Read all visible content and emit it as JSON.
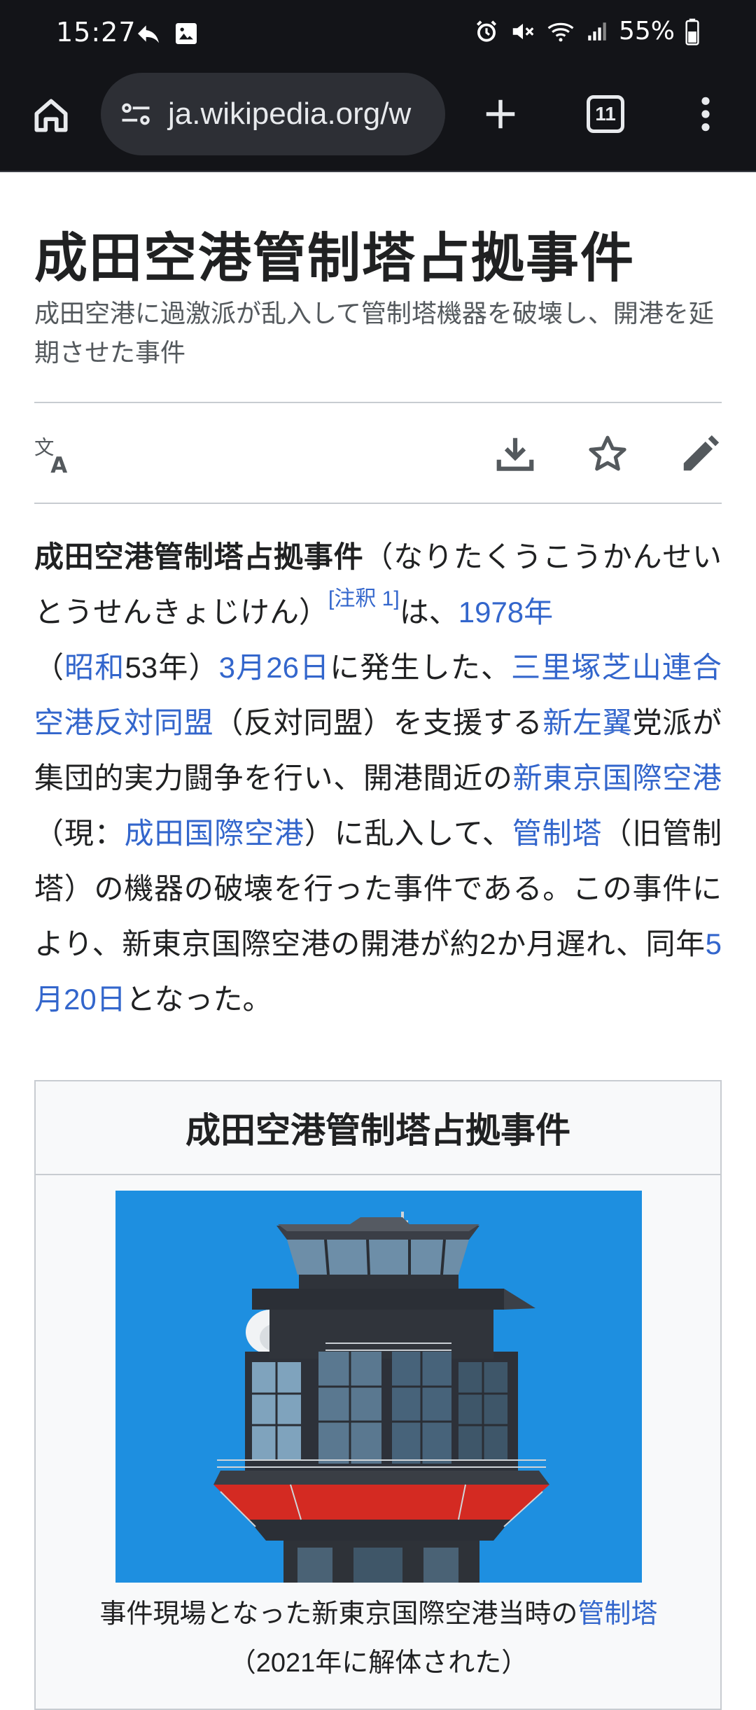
{
  "status_bar": {
    "time": "15:27",
    "battery": "55%",
    "icons": [
      "reply-arrow-icon",
      "gallery-icon",
      "alarm-icon",
      "mute-icon",
      "wifi-icon",
      "signal-icon",
      "battery-icon"
    ]
  },
  "browser": {
    "url": "ja.wikipedia.org/w",
    "tab_count": "11",
    "icons": [
      "home-icon",
      "site-info-icon",
      "plus-icon",
      "tabs-icon",
      "more-vert-icon"
    ]
  },
  "article": {
    "title": "成田空港管制塔占拠事件",
    "subtitle": "成田空港に過激派が乱入して管制塔機器を破壊し、開港を延期させた事件",
    "actions": [
      "language-icon",
      "download-icon",
      "star-icon",
      "edit-icon"
    ],
    "lead": {
      "bold_title": "成田空港管制塔占拠事件",
      "reading": "（なりたくうこうかんせいとうせんきょじけん）",
      "note": "[注釈 1]",
      "t1": "は、",
      "link_year": "1978年",
      "t2": "（",
      "link_showa": "昭和",
      "t3": "53年）",
      "link_date": "3月26日",
      "t4": "に発生した、",
      "link_league": "三里塚芝山連合空港反対同盟",
      "t5": "（反対同盟）を支援する",
      "link_newleft": "新左翼",
      "t6": "党派が集団的実力闘争を行い、開港間近の",
      "link_airport": "新東京国際空港",
      "t7": "（現：",
      "link_narita": "成田国際空港",
      "t8": "）に乱入して、",
      "link_tower": "管制塔",
      "t9": "（旧管制塔）の機器の破壊を行った事件である。この事件により、新東京国際空港の開港が約2か月遅れ、同年",
      "link_may": "5月20日",
      "t10": "となった。"
    },
    "infobox": {
      "title": "成田空港管制塔占拠事件",
      "caption_pre": "事件現場となった新東京国際空港当時の",
      "caption_link": "管制塔",
      "caption_post": "（2021年に解体された）"
    }
  },
  "colors": {
    "link": "#3366cc",
    "toolbar_bg": "#131418",
    "url_pill_bg": "#2d2f35",
    "sky": "#1e8fe0"
  }
}
